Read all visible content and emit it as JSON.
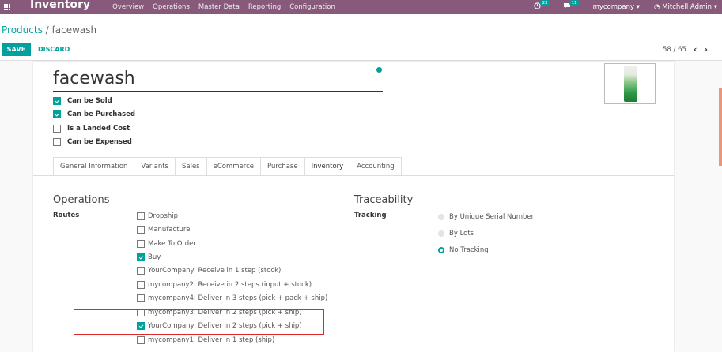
{
  "navbar": {
    "app_name": "Inventory",
    "menu": [
      "Overview",
      "Operations",
      "Master Data",
      "Reporting",
      "Configuration"
    ],
    "activity_count": "23",
    "message_count": "11",
    "company": "mycompany",
    "user": "Mitchell Admin"
  },
  "breadcrumb": {
    "parent": "Products",
    "separator": "/",
    "current": "facewash"
  },
  "buttons": {
    "save": "SAVE",
    "discard": "DISCARD"
  },
  "pager": {
    "value": "58 / 65"
  },
  "product": {
    "name": "facewash",
    "flags": [
      {
        "label": "Can be Sold",
        "checked": true
      },
      {
        "label": "Can be Purchased",
        "checked": true
      },
      {
        "label": "Is a Landed Cost",
        "checked": false
      },
      {
        "label": "Can be Expensed",
        "checked": false
      }
    ]
  },
  "tabs": [
    "General Information",
    "Variants",
    "Sales",
    "eCommerce",
    "Purchase",
    "Inventory",
    "Accounting"
  ],
  "active_tab": "Inventory",
  "operations": {
    "title": "Operations",
    "routes_label": "Routes",
    "routes": [
      {
        "label": "Dropship",
        "checked": false
      },
      {
        "label": "Manufacture",
        "checked": false
      },
      {
        "label": "Make To Order",
        "checked": false
      },
      {
        "label": "Buy",
        "checked": true
      },
      {
        "label": "YourCompany: Receive in 1 step (stock)",
        "checked": false
      },
      {
        "label": "mycompany2: Receive in 2 steps (input + stock)",
        "checked": false
      },
      {
        "label": "mycompany4: Deliver in 3 steps (pick + pack + ship)",
        "checked": false
      },
      {
        "label": "mycompany3: Deliver in 2 steps (pick + ship)",
        "checked": false
      },
      {
        "label": "YourCompany: Deliver in 2 steps (pick + ship)",
        "checked": true
      },
      {
        "label": "mycompany1: Deliver in 1 step (ship)",
        "checked": false
      }
    ]
  },
  "traceability": {
    "title": "Traceability",
    "tracking_label": "Tracking",
    "options": [
      {
        "label": "By Unique Serial Number",
        "selected": false
      },
      {
        "label": "By Lots",
        "selected": false
      },
      {
        "label": "No Tracking",
        "selected": true
      }
    ]
  },
  "colors": {
    "navbar": "#875a7b",
    "primary": "#00a09d",
    "highlight": "#e02828"
  }
}
